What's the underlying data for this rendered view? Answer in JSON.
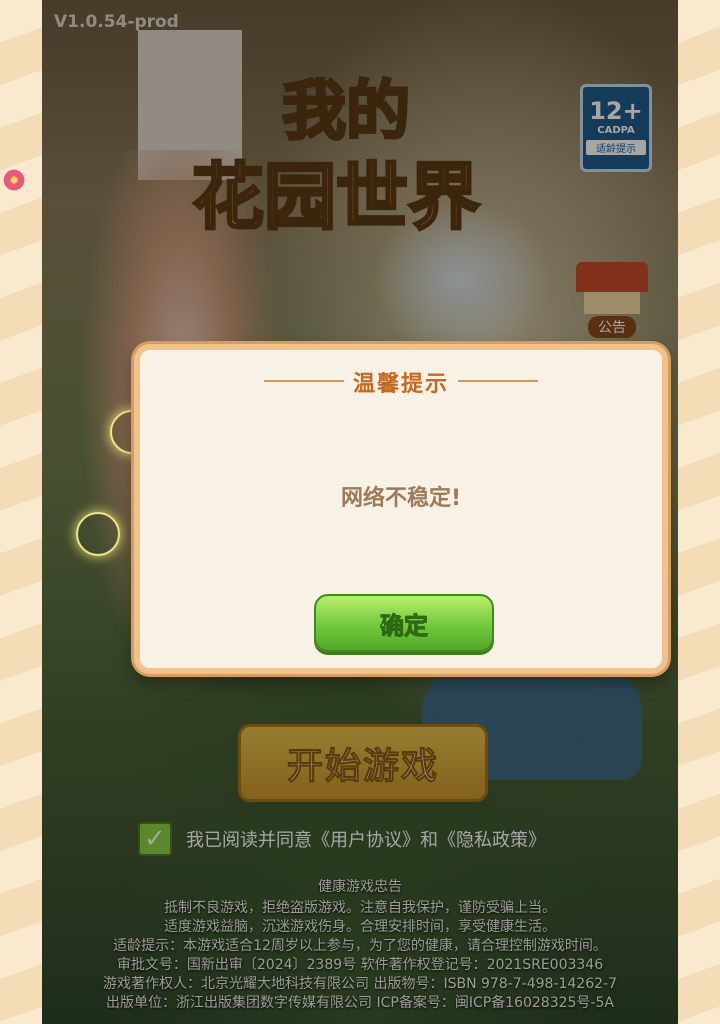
{
  "version": "V1.0.54-prod",
  "game_title": {
    "line1": "我的",
    "line2": "花园世界"
  },
  "age_rating": {
    "age": "12+",
    "org": "CADPA",
    "tip": "适龄提示"
  },
  "notice_label": "公告",
  "dialog": {
    "title": "温馨提示",
    "message": "网络不稳定!",
    "ok_label": "确定"
  },
  "start_label": "开始游戏",
  "agreement": {
    "checked": true,
    "text": "我已阅读并同意《用户协议》和《隐私政策》"
  },
  "health_notice": {
    "heading": "健康游戏忠告",
    "lines": [
      "抵制不良游戏，拒绝盗版游戏。注意自我保护，谨防受骗上当。",
      "适度游戏益脑，沉迷游戏伤身。合理安排时间，享受健康生活。",
      "适龄提示：本游戏适合12周岁以上参与，为了您的健康，请合理控制游戏时间。",
      "审批文号：国新出审〔2024〕2389号  软件著作权登记号：2021SRE003346",
      "游戏著作权人：北京光耀大地科技有限公司  出版物号：ISBN 978-7-498-14262-7",
      "出版单位：浙江出版集团数字传媒有限公司  ICP备案号：闽ICP备16028325号-5A"
    ]
  },
  "colors": {
    "dialog_title": "#c46a20",
    "ok_button": "#6cc63a",
    "start_button": "#e8c04c"
  }
}
